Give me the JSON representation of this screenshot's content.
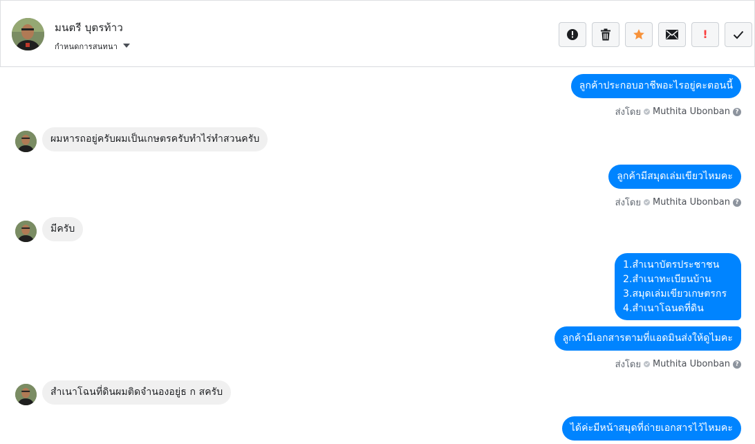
{
  "header": {
    "contact_name": "มนตรี บุตรท้าว",
    "assign_label": "กำหนดการสนทนา"
  },
  "actions": [
    {
      "icon": "alert-circle-icon",
      "label": "Mark as spam"
    },
    {
      "icon": "trash-icon",
      "label": "Delete"
    },
    {
      "icon": "star-icon",
      "label": "Star",
      "color": "#f7923a"
    },
    {
      "icon": "envelope-icon",
      "label": "Mark as unread"
    },
    {
      "icon": "exclamation-icon",
      "label": "!",
      "color": "#fa3e3e"
    },
    {
      "icon": "check-icon",
      "label": "Done"
    }
  ],
  "colors": {
    "outgoing_bubble": "#0084ff",
    "incoming_bubble": "#f0f0f0"
  },
  "messages": [
    {
      "dir": "out",
      "text": "ลูกค้าประกอบอาชีพอะไรอยู่คะตอนนี้"
    },
    {
      "dir": "meta",
      "prefix": "ส่งโดย",
      "sender": "Muthita Ubonban"
    },
    {
      "dir": "in",
      "text": "ผมหารถอยู่ครับผมเป็นเกษตรครับทำไร่ทำสวนครับ"
    },
    {
      "dir": "out",
      "text": "ลูกค้ามีสมุดเล่มเขียวไหมคะ"
    },
    {
      "dir": "meta",
      "prefix": "ส่งโดย",
      "sender": "Muthita Ubonban"
    },
    {
      "dir": "in",
      "text": "มีครับ"
    },
    {
      "dir": "out",
      "lines": [
        "1.สำเนาบัตรประชาชน",
        "2.สำเนาทะเบียนบ้าน",
        "3.สมุดเล่มเขียวเกษตรกร",
        "4.สำเนาโฉนดที่ดิน"
      ]
    },
    {
      "dir": "out",
      "text": "ลูกค้ามีเอกสารตามที่แอดมินส่งให้ดูไมคะ"
    },
    {
      "dir": "meta",
      "prefix": "ส่งโดย",
      "sender": "Muthita Ubonban"
    },
    {
      "dir": "in",
      "text": "สำเนาโฉนที่ดินผมติดจำนองอยู่ธ ก สครับ"
    },
    {
      "dir": "out",
      "text": "ได้ค่ะมีหน้าสมุดที่ถ่ายเอกสารไว้ไหมคะ"
    }
  ]
}
